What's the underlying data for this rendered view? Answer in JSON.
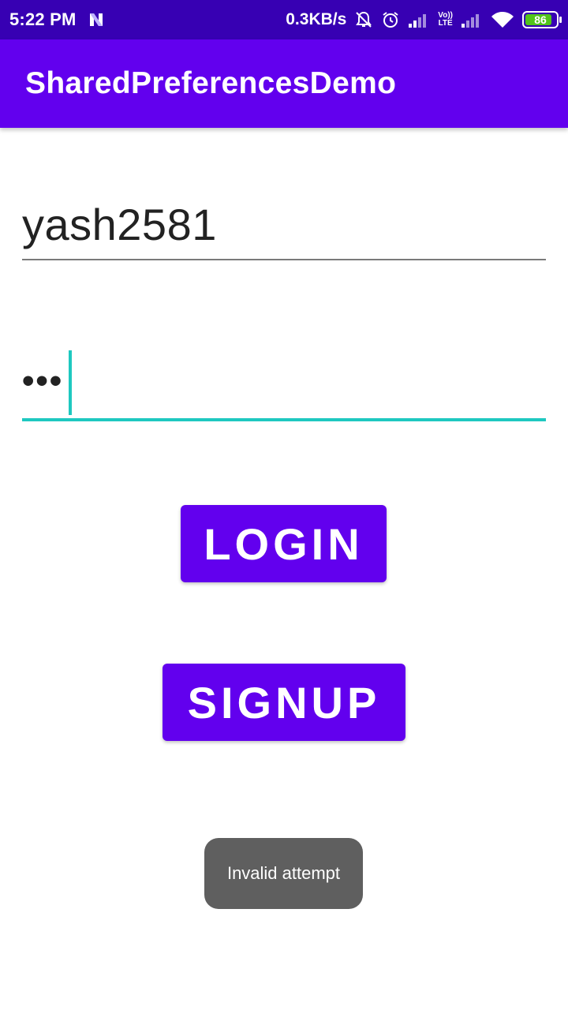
{
  "status_bar": {
    "time": "5:22 PM",
    "net_speed": "0.3KB/s",
    "volte_top": "Vo))",
    "volte_bottom": "LTE",
    "battery": "86",
    "battery_level": 0.86,
    "icons": [
      "n-notification-icon",
      "alarm-muted-icon",
      "alarm-clock-icon",
      "signal-icon",
      "volte-icon",
      "signal-icon",
      "wifi-icon",
      "battery-icon"
    ],
    "colors": {
      "background": "#3700b3",
      "battery_fill": "#52c41a"
    }
  },
  "app_bar": {
    "title": "SharedPreferencesDemo",
    "color": "#6200ee"
  },
  "form": {
    "username_value": "yash2581",
    "password_mask": "•••",
    "focus_color": "#1ec8c0"
  },
  "buttons": {
    "login_label": "LOGIN",
    "signup_label": "SIGNUP",
    "color": "#6200ee"
  },
  "toast": {
    "message": "Invalid attempt"
  }
}
